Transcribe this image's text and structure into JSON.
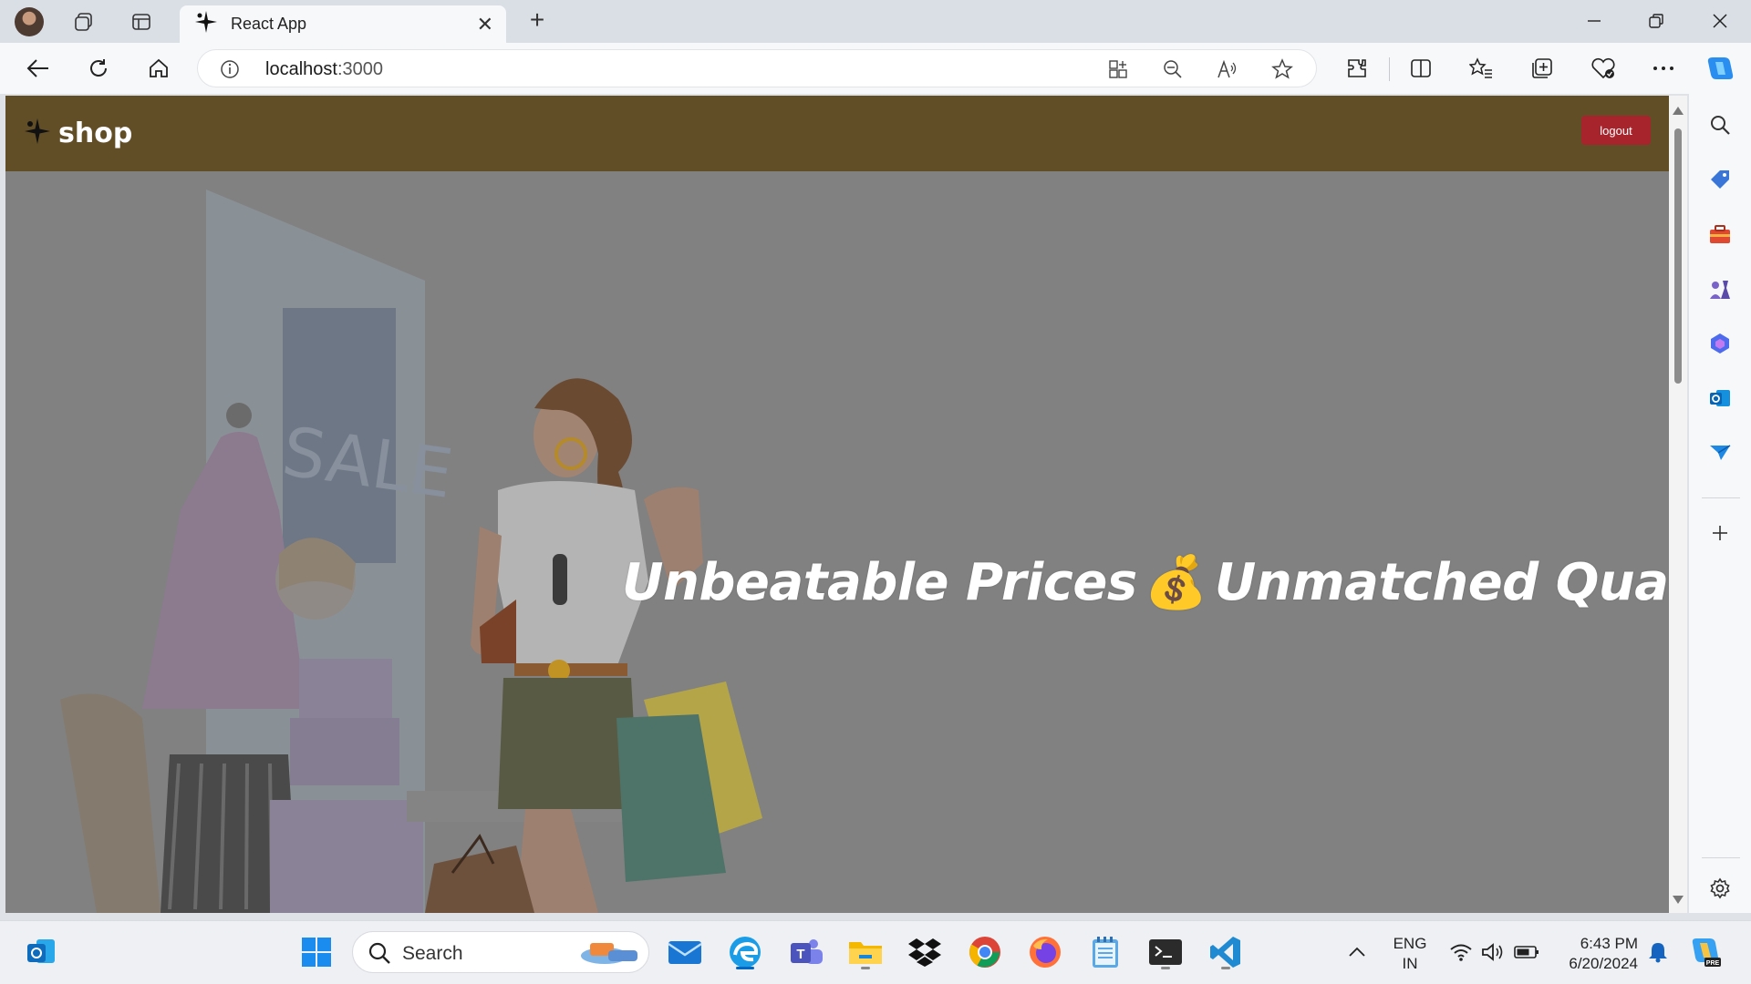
{
  "browser": {
    "tab_title": "React App",
    "url_host": "localhost",
    "url_port": ":3000"
  },
  "app": {
    "brand_name": "shop",
    "logout_label": "logout",
    "hero_text_part1": "Unbeatable Prices",
    "hero_emoji": "💰",
    "hero_text_part2": "Unmatched Quality",
    "hero_art_label": "SALE"
  },
  "taskbar": {
    "search_label": "Search",
    "lang_line1": "ENG",
    "lang_line2": "IN",
    "time": "6:43 PM",
    "date": "6/20/2024"
  },
  "colors": {
    "app_header": "#614e27",
    "logout_button": "#a8242c",
    "hero_overlay": "#818181"
  }
}
